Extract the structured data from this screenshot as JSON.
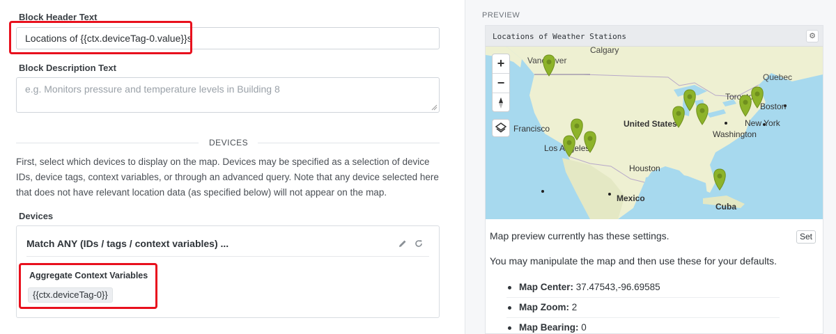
{
  "form": {
    "header_label": "Block Header Text",
    "header_value": "Locations of {{ctx.deviceTag-0.value}}s",
    "description_label": "Block Description Text",
    "description_placeholder": "e.g. Monitors pressure and temperature levels in Building 8",
    "devices_section_title": "DEVICES",
    "devices_help": "First, select which devices to display on the map. Devices may be specified as a selection of device IDs, device tags, context variables, or through an advanced query. Note that any device selected here that does not have relevant location data (as specified below) will not appear on the map.",
    "devices_label": "Devices",
    "devices_card": {
      "header": "Match ANY (IDs / tags / context variables) ...",
      "edit_icon": "pencil-icon",
      "reset_icon": "refresh-icon",
      "aggregate_label": "Aggregate Context Variables",
      "chip": "{{ctx.deviceTag-0}}"
    }
  },
  "preview": {
    "title": "PREVIEW",
    "map_header": "Locations of Weather Stations",
    "gear_icon": "gear-icon",
    "zoom_in": "+",
    "zoom_out": "−",
    "map_labels": {
      "calgary": "Calgary",
      "vancouver": "Vancouver",
      "quebec": "Quebec",
      "toronto": "Toronto",
      "boston": "Boston",
      "new_york": "New York",
      "washington": "Washington",
      "united_states": "United States",
      "san_francisco": "Francisco",
      "los_angeles": "Los Angeles",
      "houston": "Houston",
      "mexico": "Mexico",
      "cuba": "Cuba"
    },
    "marker_color": "#8db32a",
    "info_text": "Map preview currently has these settings.",
    "set_button": "Set",
    "info_text_2": "You may manipulate the map and then use these for your defaults.",
    "settings": [
      {
        "key": "Map Center:",
        "value": "37.47543,-96.69585"
      },
      {
        "key": "Map Zoom:",
        "value": "2"
      },
      {
        "key": "Map Bearing:",
        "value": "0"
      }
    ]
  },
  "colors": {
    "highlight_red": "#e8101d",
    "water": "#a7d9ee",
    "land": "#eef0d2"
  }
}
